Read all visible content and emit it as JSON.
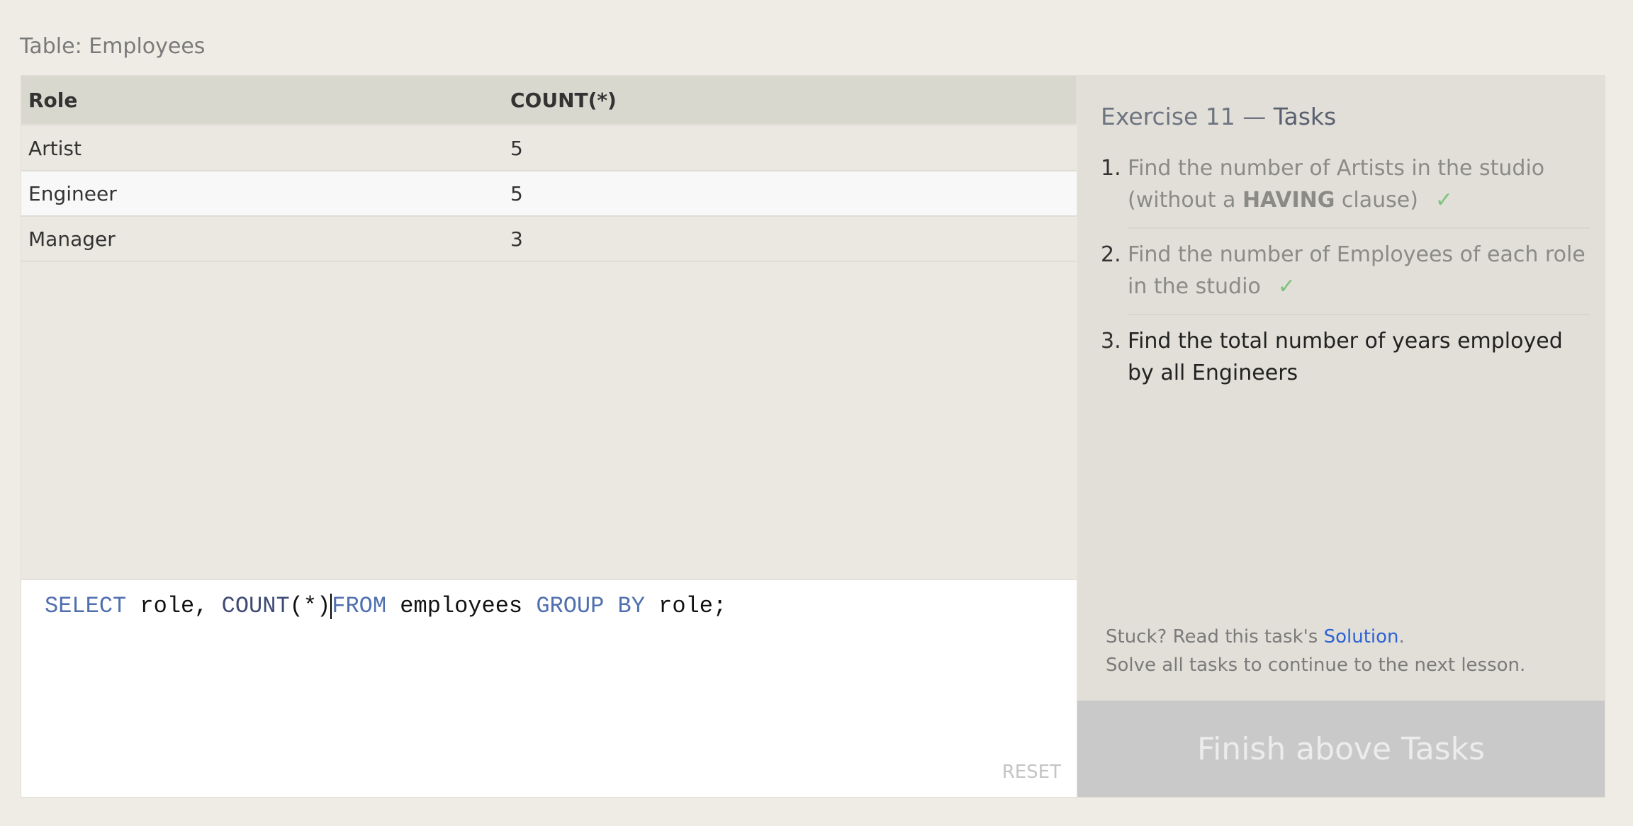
{
  "table_title": "Table: Employees",
  "result": {
    "columns": [
      "Role",
      "COUNT(*)"
    ],
    "rows": [
      [
        "Artist",
        "5"
      ],
      [
        "Engineer",
        "5"
      ],
      [
        "Manager",
        "3"
      ]
    ]
  },
  "editor": {
    "tokens": {
      "select": "SELECT",
      "role1": " role, ",
      "count": "COUNT",
      "parens": "(*)",
      "from": "FROM",
      "employees": " employees ",
      "groupby": "GROUP BY",
      "role2": " role;"
    },
    "reset_label": "RESET"
  },
  "exercise": {
    "title_prefix": "Exercise 11 — ",
    "title_suffix": "Tasks",
    "tasks": [
      {
        "num": "1.",
        "text_a": "Find the number of Artists in the studio (without a ",
        "bold": "HAVING",
        "text_b": " clause)",
        "status": "done",
        "check": "✓"
      },
      {
        "num": "2.",
        "text_a": "Find the number of Employees of each role in the studio",
        "status": "done",
        "check": "✓"
      },
      {
        "num": "3.",
        "text_a": "Find the total number of years employed by all Engineers",
        "status": "current"
      }
    ],
    "stuck_prefix": "Stuck? Read this task's ",
    "solution_link": "Solution",
    "stuck_suffix": ".",
    "solve_all": "Solve all tasks to continue to the next lesson.",
    "finish_button": "Finish above Tasks"
  },
  "colors": {
    "keyword": "#4f6fae",
    "check": "#7ec27e",
    "link": "#2e63d6"
  }
}
